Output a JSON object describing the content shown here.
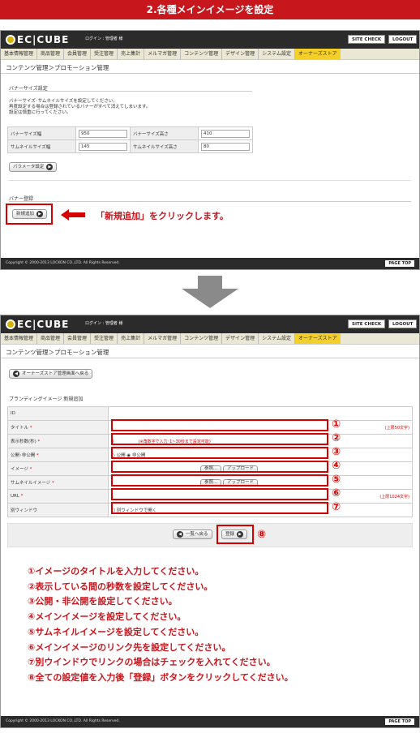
{
  "banner": "2.各種メインイメージを設定",
  "header": {
    "logo": "EC|CUBE",
    "login": "ログイン : 管理者 様",
    "site_check": "SITE CHECK",
    "logout": "LOGOUT"
  },
  "nav": [
    "基本情報管理",
    "商品管理",
    "会員管理",
    "受注管理",
    "売上集計",
    "メルマガ管理",
    "コンテンツ管理",
    "デザイン管理",
    "システム設定",
    "オーナーズストア"
  ],
  "breadcrumb": "コンテンツ管理＞プロモーション管理",
  "screen1": {
    "section_title": "バナーサイズ設定",
    "notes": [
      "バナーサイズ･サムネイルサイズを設定してください。",
      "再度設定する場合は登録されているバナーがすべて消えてしまいます。",
      "設定は慎重に行ってください。"
    ],
    "rows": [
      {
        "l1": "バナーサイズ幅",
        "v1": "950",
        "l2": "バナーサイズ高さ",
        "v2": "410"
      },
      {
        "l1": "サムネイルサイズ幅",
        "v1": "145",
        "l2": "サムネイルサイズ高さ",
        "v2": "80"
      }
    ],
    "param_button": "パラメータ設定",
    "banner_section": "バナー登録",
    "new_button": "新規追加",
    "callout": "「新規追加」をクリックします。"
  },
  "screen2": {
    "back_button": "オーナーズストア管理画面へ戻る",
    "section_title": "ブランディングイメージ 新規追加",
    "rows": [
      {
        "label": "ID",
        "req": "",
        "value": "",
        "limit": ""
      },
      {
        "label": "タイトル",
        "req": "*",
        "value": "",
        "limit": "(上限50文字)"
      },
      {
        "label": "表示秒数(秒)",
        "req": "*",
        "value": "0",
        "limit": "(※角数字で入力･1~30秒まで設定可能)"
      },
      {
        "label": "公開･非公開",
        "req": "*",
        "value": "",
        "limit": ""
      },
      {
        "label": "イメージ",
        "req": "*",
        "value": "",
        "limit": ""
      },
      {
        "label": "サムネイルイメージ",
        "req": "*",
        "value": "",
        "limit": ""
      },
      {
        "label": "URL",
        "req": "*",
        "value": "",
        "limit": "(上限1024文字)"
      },
      {
        "label": "別ウィンドウ",
        "req": "",
        "value": "",
        "limit": ""
      }
    ],
    "radio_public": "公開",
    "radio_private": "非公開",
    "browse": "参照...",
    "upload": "アップロード",
    "checkbox_label": "別ウィンドウで開く",
    "list_button": "一覧へ戻る",
    "register_button": "登録",
    "circles": [
      "①",
      "②",
      "③",
      "④",
      "⑤",
      "⑥",
      "⑦",
      "⑧"
    ]
  },
  "instructions": [
    "①イメージのタイトルを入力してください。",
    "②表示している間の秒数を設定してください。",
    "③公開・非公開を設定してください。",
    "④メインイメージを設定してください。",
    "⑤サムネイルイメージを設定してください。",
    "⑥メインイメージのリンク先を設定してください。",
    "⑦別ウインドウでリンクの場合はチェックを入れてください。",
    "⑧全ての設定値を入力後「登録」ボタンをクリックしてください。"
  ],
  "footer": {
    "copyright": "Copyright © 2000-2013 LOCKON CO.,LTD. All Rights Reserved.",
    "page_top": "PAGE TOP"
  },
  "colors": {
    "accent": "#c8161d",
    "store_tab": "#f4cf2a",
    "header": "#2b2b2b"
  }
}
